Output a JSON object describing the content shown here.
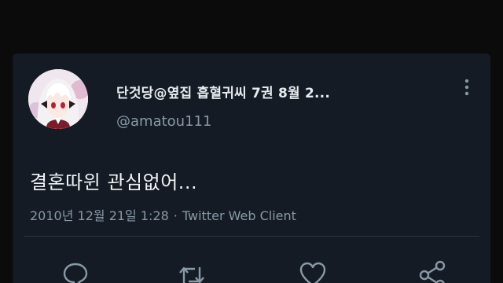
{
  "tweet": {
    "display_name": "단것당@옆집 흡혈귀씨 7권 8월 2...",
    "handle": "@amatou111",
    "text": "결혼따윈 관심없어...",
    "date": "2010년 12월 21일 1:28",
    "separator": "·",
    "client": "Twitter Web Client"
  },
  "icons": {
    "more": "more-vertical-icon",
    "reply": "reply-icon",
    "retweet": "retweet-icon",
    "like": "heart-icon",
    "share": "share-icon"
  },
  "colors": {
    "card_background": "#141b24",
    "page_background": "#0b0b0b",
    "primary_text": "#e8ecf0",
    "secondary_text": "#8899a6"
  }
}
